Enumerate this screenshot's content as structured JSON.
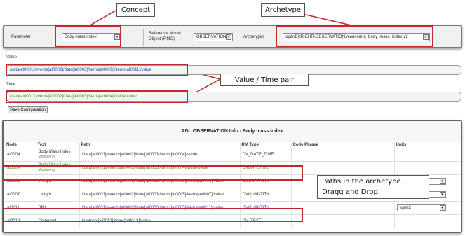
{
  "callouts": {
    "concept": "Concept",
    "archetype": "Archetype",
    "value_time_pair": "Value / Time pair",
    "paths_line1": "Paths in the archetype.",
    "paths_line2": "Dragg and Drop"
  },
  "config": {
    "parameter_label": "Parameter",
    "parameter_value": "Body mass index",
    "rm_label_line1": "Reference Model",
    "rm_label_line2": "Object (RMO)",
    "rm_value": "OBSERVATION",
    "archetypes_label": "Archetypes",
    "archetype_value": "openEHR-EHR-OBSERVATION.monitoring_body_mass_index.v1"
  },
  "value": {
    "label": "Value",
    "path": "/data[at0001]/events[at0002]/data[at0003]/items[at0005]/items[at0011]/value"
  },
  "time": {
    "label": "Time",
    "path": "/data[at0001]/events[at0002]/data[at0003]/items[at0004]/value/value"
  },
  "save_button": "Save Configuration",
  "adl": {
    "title": "ADL OBSERVATION Info - Body mass index",
    "headers": [
      "Node",
      "Text",
      "Path",
      "RM Type",
      "Code Phrase",
      "Units"
    ],
    "rows": [
      {
        "node": "at0004",
        "text": "Body Mass Index",
        "sub": "Monitoring",
        "path": "/data[at0001]/events[at0002]/data[at0003]/items[at0004]/value",
        "rm_type": "DV_DATE_TIME",
        "code": "",
        "unit": ""
      },
      {
        "node": "at0004",
        "text": "Body Mass Index",
        "sub": "Monitoring",
        "path": "/data[at0001]/events[at0002]/data[at0003]/items[at0004]/value/value",
        "rm_type": "DVDATETIME",
        "code": "",
        "unit": ""
      },
      {
        "node": "at0006",
        "text": "Weight",
        "sub": "",
        "path": "/data[at0001]/events[at0002]/data[at0003]/items[at0005]/items[at0006]/value",
        "rm_type": "DVQUANTITY",
        "code": "",
        "unit": "kg"
      },
      {
        "node": "at0007",
        "text": "Length",
        "sub": "",
        "path": "/data[at0001]/events[at0002]/data[at0003]/items[at0005]/items[at0007]/value",
        "rm_type": "DVQUANTITY",
        "code": "",
        "unit": "m"
      },
      {
        "node": "at0011",
        "text": "BMI",
        "sub": "",
        "path": "/data[at0001]/events[at0002]/data[at0003]/items[at0005]/items[at0011]/value",
        "rm_type": "DVQUANTITY",
        "code": "",
        "unit": "kg/m2"
      },
      {
        "node": "at0012",
        "text": "Comment",
        "sub": "",
        "path": "/protocol[at0012]/items[at0012]/value",
        "rm_type": "DV_TEXT",
        "code": "",
        "unit": ""
      }
    ]
  },
  "icons": {
    "dropdown": "chevron-down-icon"
  },
  "colors": {
    "highlight": "#c0282a",
    "path_blue": "#3a3aa8",
    "path_green": "#3d8a2c"
  }
}
